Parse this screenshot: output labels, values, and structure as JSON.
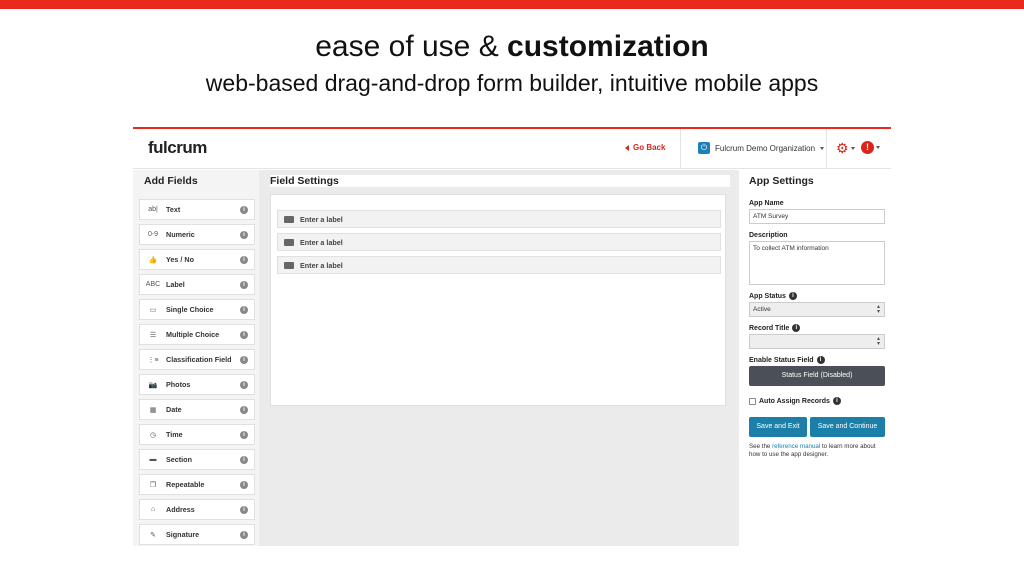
{
  "slide": {
    "title_plain": "ease of use & ",
    "title_bold": "customization",
    "subtitle": "web-based drag-and-drop form builder, intuitive mobile apps"
  },
  "header": {
    "logo": "fulcrum",
    "go_back": "Go Back",
    "organization": "Fulcrum Demo Organization"
  },
  "add_fields": {
    "title": "Add Fields",
    "items": [
      {
        "label": "Text",
        "icon": "text-field-icon",
        "glyph": "ab|"
      },
      {
        "label": "Numeric",
        "icon": "numeric-field-icon",
        "glyph": "0-9"
      },
      {
        "label": "Yes / No",
        "icon": "thumbs-up-icon",
        "glyph": "👍"
      },
      {
        "label": "Label",
        "icon": "label-field-icon",
        "glyph": "ABC"
      },
      {
        "label": "Single Choice",
        "icon": "single-choice-icon",
        "glyph": "▭"
      },
      {
        "label": "Multiple Choice",
        "icon": "multiple-choice-icon",
        "glyph": "☰"
      },
      {
        "label": "Classification Field",
        "icon": "classification-icon",
        "glyph": "⋮≡"
      },
      {
        "label": "Photos",
        "icon": "camera-icon",
        "glyph": "📷"
      },
      {
        "label": "Date",
        "icon": "calendar-icon",
        "glyph": "▦"
      },
      {
        "label": "Time",
        "icon": "clock-icon",
        "glyph": "◷"
      },
      {
        "label": "Section",
        "icon": "section-icon",
        "glyph": "▬"
      },
      {
        "label": "Repeatable",
        "icon": "repeatable-icon",
        "glyph": "❐"
      },
      {
        "label": "Address",
        "icon": "home-icon",
        "glyph": "⌂"
      },
      {
        "label": "Signature",
        "icon": "pencil-icon",
        "glyph": "✎"
      }
    ]
  },
  "field_settings": {
    "title": "Field Settings",
    "rows": [
      "Enter a label",
      "Enter a label",
      "Enter a label"
    ]
  },
  "app_settings": {
    "title": "App Settings",
    "app_name_label": "App Name",
    "app_name_value": "ATM Survey",
    "description_label": "Description",
    "description_value": "To collect ATM information",
    "app_status_label": "App Status",
    "app_status_value": "Active",
    "record_title_label": "Record Title",
    "record_title_value": "",
    "enable_status_label": "Enable Status Field",
    "status_button": "Status Field (Disabled)",
    "auto_assign_label": "Auto Assign Records",
    "save_exit": "Save and Exit",
    "save_continue": "Save and Continue",
    "help_prefix": "See the ",
    "help_link": "reference manual",
    "help_suffix": " to learn more about how to use the app designer."
  },
  "colors": {
    "accent_red": "#e8291c",
    "button_blue": "#1c7fa8",
    "button_dark": "#4b4f57"
  }
}
